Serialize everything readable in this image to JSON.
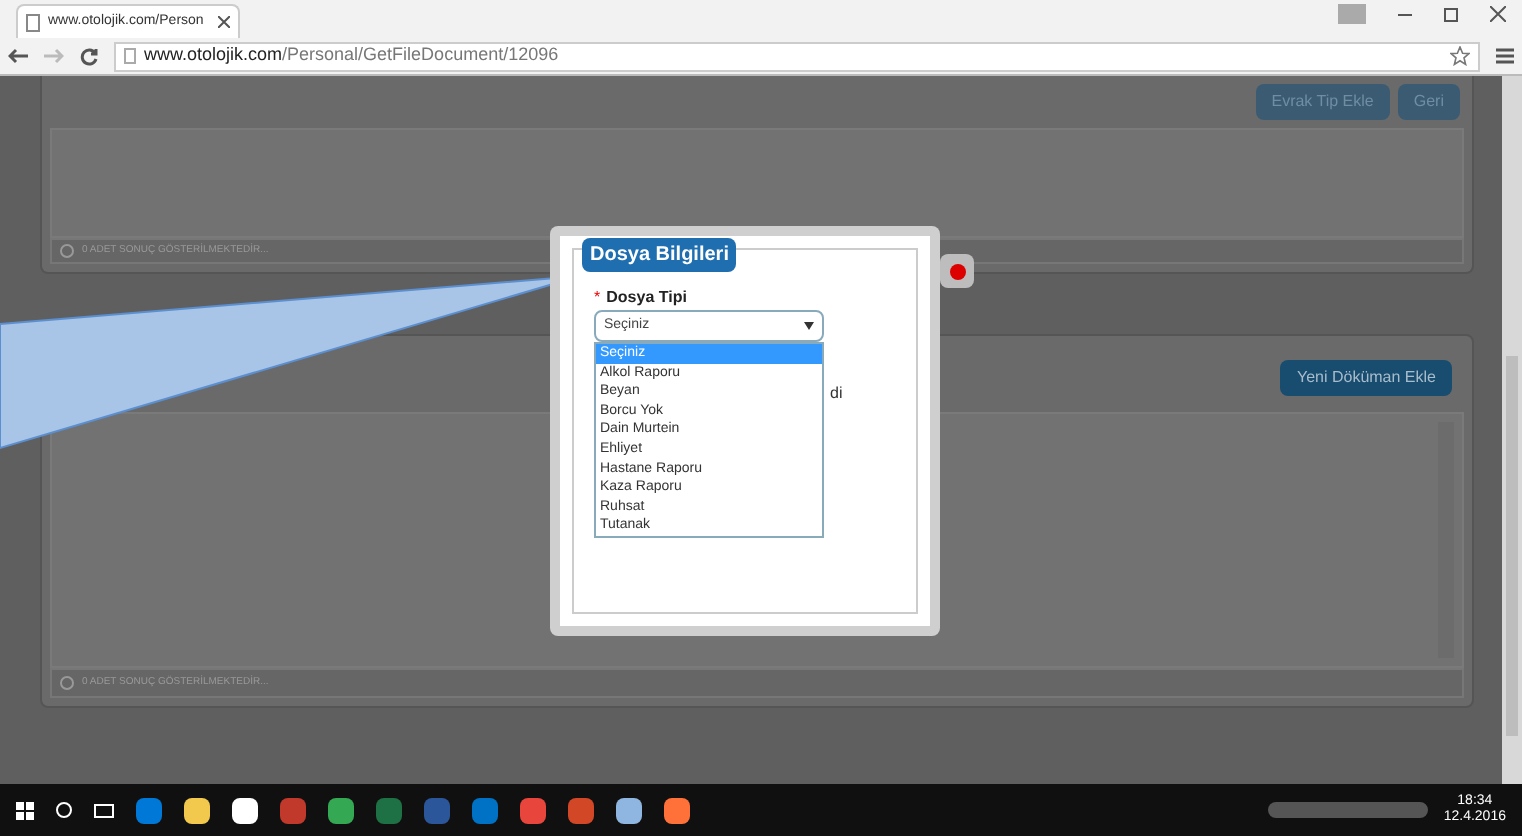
{
  "browser": {
    "tab_title": "www.otolojik.com/Person",
    "url_host": "www.otolojik.com",
    "url_path": "/Personal/GetFileDocument/12096"
  },
  "top_buttons": [
    "Evrak Tip Ekle",
    "Geri"
  ],
  "panels": [
    {
      "footer": "0 ADET SONUÇ GÖSTERİLMEKTEDİR..."
    },
    {
      "button": "Yeni Döküman Ekle",
      "footer": "0 ADET SONUÇ GÖSTERİLMEKTEDİR..."
    }
  ],
  "modal": {
    "legend": "Dosya Bilgileri",
    "field_label": "Dosya Tipi",
    "required_mark": "*",
    "select_value": "Seçiniz",
    "behind_text": "di",
    "options": [
      {
        "label": "Seçiniz",
        "selected": true
      },
      {
        "label": "Alkol Raporu",
        "selected": false
      },
      {
        "label": "Beyan",
        "selected": false
      },
      {
        "label": "Borcu Yok",
        "selected": false
      },
      {
        "label": "Dain Murtein",
        "selected": false
      },
      {
        "label": "Ehliyet",
        "selected": false
      },
      {
        "label": "Hastane Raporu",
        "selected": false
      },
      {
        "label": "Kaza Raporu",
        "selected": false
      },
      {
        "label": "Ruhsat",
        "selected": false
      },
      {
        "label": "Tutanak",
        "selected": false
      }
    ]
  },
  "taskbar": {
    "time": "18:34",
    "date": "12.4.2016"
  }
}
